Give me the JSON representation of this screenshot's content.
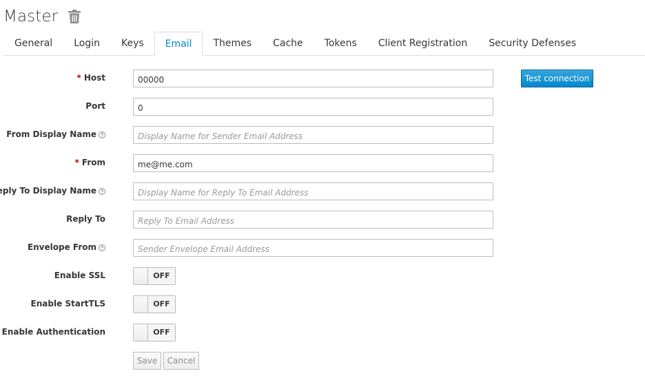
{
  "header": {
    "title": "Master"
  },
  "tabs": [
    {
      "label": "General"
    },
    {
      "label": "Login"
    },
    {
      "label": "Keys"
    },
    {
      "label": "Email"
    },
    {
      "label": "Themes"
    },
    {
      "label": "Cache"
    },
    {
      "label": "Tokens"
    },
    {
      "label": "Client Registration"
    },
    {
      "label": "Security Defenses"
    }
  ],
  "active_tab": "Email",
  "form": {
    "host": {
      "label": "Host",
      "required_marker": "*",
      "value": "00000"
    },
    "port": {
      "label": "Port",
      "value": "0"
    },
    "from_display_name": {
      "label": "From Display Name",
      "placeholder": "Display Name for Sender Email Address",
      "value": ""
    },
    "from": {
      "label": "From",
      "required_marker": "*",
      "value": "me@me.com"
    },
    "reply_to_display_name": {
      "label": "Reply To Display Name",
      "placeholder": "Display Name for Reply To Email Address",
      "value": ""
    },
    "reply_to": {
      "label": "Reply To",
      "placeholder": "Reply To Email Address",
      "value": ""
    },
    "envelope_from": {
      "label": "Envelope From",
      "placeholder": "Sender Envelope Email Address",
      "value": ""
    },
    "enable_ssl": {
      "label": "Enable SSL",
      "state": "OFF"
    },
    "enable_starttls": {
      "label": "Enable StartTLS",
      "state": "OFF"
    },
    "enable_authentication": {
      "label": "Enable Authentication",
      "state": "OFF"
    },
    "test_connection_label": "Test connection",
    "save_label": "Save",
    "cancel_label": "Cancel"
  },
  "icons": {
    "delete": "trash-icon",
    "help": "question-circle-icon"
  },
  "colors": {
    "accent": "#0088ce",
    "required": "#c00000",
    "border": "#bbbbbb",
    "text": "#363636",
    "placeholder": "#999999"
  }
}
